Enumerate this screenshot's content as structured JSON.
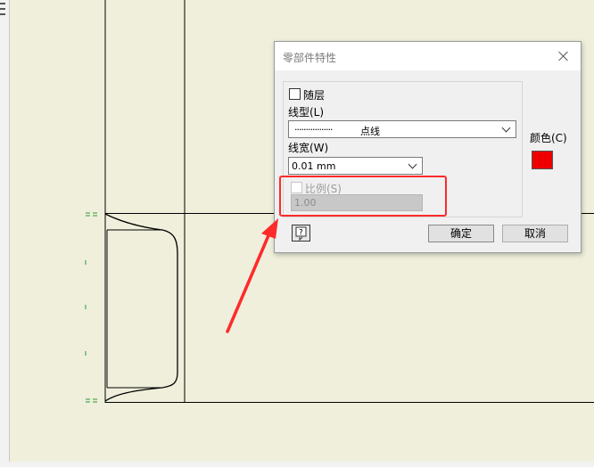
{
  "dialog": {
    "title": "零部件特性",
    "by_layer_label": "随层",
    "linetype_label": "线型(L)",
    "linetype_value": "点线",
    "linetype_pattern": "·················",
    "lineweight_label": "线宽(W)",
    "lineweight_value": "0.01 mm",
    "scale_label": "比例(S)",
    "scale_value": "1.00",
    "color_label": "颜色(C)",
    "color_value": "#ee0000",
    "ok_label": "确定",
    "cancel_label": "取消"
  },
  "colors": {
    "canvas_bg": "#efefdc",
    "annotation_red": "#ff2a2a",
    "drawing_line": "#000000",
    "marker_green": "#2e9a2e"
  }
}
